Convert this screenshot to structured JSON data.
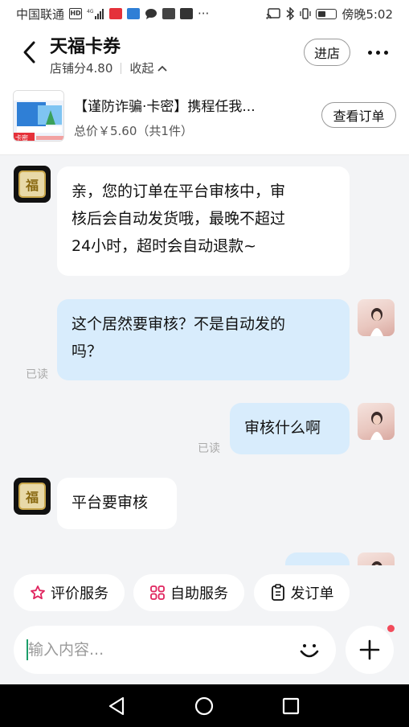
{
  "status_bar": {
    "carrier": "中国联通",
    "network": "4G",
    "time": "傍晚5:02",
    "battery_level": 0.45
  },
  "header": {
    "shop_name": "天福卡券",
    "shop_score": "店铺分4.80",
    "collapse_label": "收起",
    "enter_shop_label": "进店"
  },
  "order": {
    "title": "【谨防诈骗·卡密】携程任我...",
    "price": "总价￥5.60（共1件）",
    "view_order_label": "查看订单",
    "thumb_badge": "卡密"
  },
  "messages": [
    {
      "from": "shop",
      "lines": [
        "亲，您的订单在平台审核中，审",
        "核后会自动发货哦，最晚不超过",
        "24小时，超时会自动退款~"
      ]
    },
    {
      "from": "user",
      "lines": [
        "这个居然要审核？不是自动发的",
        "吗？"
      ],
      "status": "已读"
    },
    {
      "from": "user",
      "lines": [
        "审核什么啊"
      ],
      "status": "已读"
    },
    {
      "from": "shop",
      "lines": [
        "平台要审核"
      ]
    }
  ],
  "shop_avatar_glyph": "福",
  "quick_actions": [
    {
      "label": "评价服务",
      "icon": "star-outline-icon",
      "color": "#e0245e"
    },
    {
      "label": "自助服务",
      "icon": "grid-icon",
      "color": "#e0245e"
    },
    {
      "label": "发订单",
      "icon": "clipboard-icon",
      "color": "#111111"
    }
  ],
  "input": {
    "placeholder": "输入内容..."
  },
  "colors": {
    "incoming_bubble": "#ffffff",
    "outgoing_bubble": "#d8ecfc",
    "background": "#f3f4f6",
    "accent_pink": "#e0245e",
    "notification_red": "#f24b5b"
  }
}
